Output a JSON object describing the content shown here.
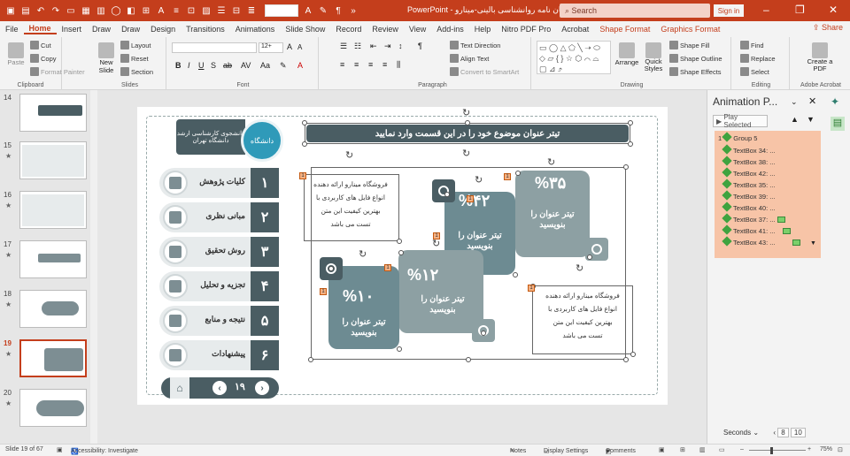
{
  "window": {
    "title": "قالب پاورپوینت پایان نامه روانشناسی بالینی-مینارو - PowerPoint",
    "search_placeholder": "Search",
    "signin_label": "Sign in",
    "share_label": "Share",
    "accent_color": "#c43e1c"
  },
  "tabs": [
    "File",
    "Home",
    "Insert",
    "Draw",
    "Draw",
    "Design",
    "Transitions",
    "Animations",
    "Slide Show",
    "Record",
    "Review",
    "View",
    "Add-ins",
    "Help",
    "Nitro PDF Pro",
    "Acrobat",
    "Shape Format",
    "Graphics Format"
  ],
  "active_tab": "Home",
  "ribbon": {
    "clipboard": {
      "paste": "Paste",
      "cut": "Cut",
      "copy": "Copy",
      "format_painter": "Format Painter",
      "label": "Clipboard"
    },
    "slides": {
      "new_slide": "New Slide",
      "layout": "Layout",
      "reset": "Reset",
      "section": "Section",
      "label": "Slides"
    },
    "font": {
      "size": "12+",
      "label": "Font"
    },
    "paragraph": {
      "text_direction": "Text Direction",
      "align_text": "Align Text",
      "convert": "Convert to SmartArt",
      "label": "Paragraph"
    },
    "drawing": {
      "arrange": "Arrange",
      "quick_styles": "Quick Styles",
      "shape_fill": "Shape Fill",
      "shape_outline": "Shape Outline",
      "shape_effects": "Shape Effects",
      "label": "Drawing"
    },
    "editing": {
      "find": "Find",
      "replace": "Replace",
      "select": "Select",
      "label": "Editing"
    },
    "acrobat": {
      "create_pdf": "Create a PDF",
      "label": "Adobe Acrobat"
    }
  },
  "thumbnails": [
    {
      "num": "14",
      "star": false
    },
    {
      "num": "15",
      "star": true
    },
    {
      "num": "16",
      "star": true
    },
    {
      "num": "17",
      "star": true
    },
    {
      "num": "18",
      "star": true
    },
    {
      "num": "19",
      "star": true,
      "current": true
    },
    {
      "num": "20",
      "star": true
    }
  ],
  "slide": {
    "title": "تیتر عنوان موضوع خود را در این قسمت وارد نمایید",
    "header_line1": "دانشجوی کارشناسی ارشد",
    "header_line2": "دانشگاه تهران",
    "logo_text": "دانشگاه",
    "menu": [
      {
        "num": "۱",
        "label": "کلیات پژوهش"
      },
      {
        "num": "۲",
        "label": "مبانی نظری"
      },
      {
        "num": "۳",
        "label": "روش تحقیق"
      },
      {
        "num": "۴",
        "label": "تجزیه و تحلیل"
      },
      {
        "num": "۵",
        "label": "نتیجه و منابع"
      },
      {
        "num": "۶",
        "label": "پیشنهادات"
      }
    ],
    "page_number": "۱۹",
    "cards": [
      {
        "pct": "%۳۵",
        "title": "تیتر عنوان را بنویسید"
      },
      {
        "pct": "%۴۲",
        "title": "تیتر عنوان را بنویسید"
      },
      {
        "pct": "%۱۲",
        "title": "تیتر عنوان را بنویسید"
      },
      {
        "pct": "%۱۰",
        "title": "تیتر عنوان را بنویسید"
      }
    ],
    "paragraph": [
      "فروشگاه مینارو ارائه دهنده",
      "انواع فایل های کاربردی با",
      "بهترین کیفیت این متن",
      "تست می باشد"
    ],
    "tags": [
      "1",
      "1",
      "1",
      "1",
      "1",
      "1",
      "1"
    ]
  },
  "animation_pane": {
    "title": "Animation P...",
    "play_selected": "Play Selected",
    "items": [
      {
        "num": "1",
        "label": "Group 5",
        "bar": false
      },
      {
        "num": "",
        "label": "TextBox 34: ...",
        "bar": false
      },
      {
        "num": "",
        "label": "TextBox 38: ...",
        "bar": false
      },
      {
        "num": "",
        "label": "TextBox 42: ...",
        "bar": false
      },
      {
        "num": "",
        "label": "TextBox 35: ...",
        "bar": false
      },
      {
        "num": "",
        "label": "TextBox 39: ...",
        "bar": false
      },
      {
        "num": "",
        "label": "TextBox 40: ...",
        "bar": false
      },
      {
        "num": "",
        "label": "TextBox 37: ...",
        "bar": true
      },
      {
        "num": "",
        "label": "TextBox 41: ...",
        "bar": true
      },
      {
        "num": "",
        "label": "TextBox 43: ...",
        "bar": true
      }
    ],
    "seconds_label": "Seconds",
    "zoom_from": "8",
    "zoom_to": "10"
  },
  "status": {
    "slide_info": "Slide 19 of 67",
    "accessibility": "Accessibility: Investigate",
    "notes": "Notes",
    "display": "Display Settings",
    "comments": "Comments",
    "zoom": "75%"
  }
}
